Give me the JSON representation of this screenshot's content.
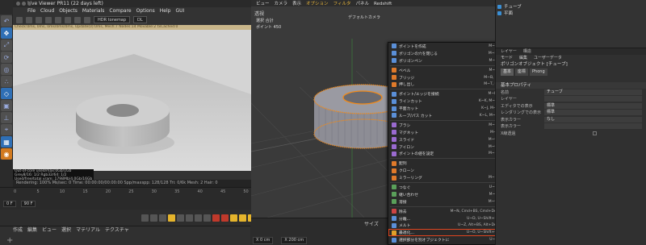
{
  "live_viewer": {
    "title": "Live Viewer PR11 (22 days left)",
    "menu": [
      "File",
      "Cloud",
      "Objects",
      "Materials",
      "Compare",
      "Options",
      "Help",
      "GUI"
    ],
    "tonemap": "HDR tonemap",
    "colorspace": "DL",
    "status": "Check:0ms, 0ms, 0ms/0ms/0ms, Update(0):0ms, Mesh:7 Nodes:14 Movable:2 txCached:0",
    "info_lines": [
      "Out-of-core used/max:0Gb/1Gb",
      "Grey8/16: 1/2        Rgb32/64: 1/2",
      "Used/free/total vram: 1798Mb/4.0Gb/16Gb"
    ],
    "bottom": "Rendering: 100%  Ms/sec: 0  Time: 00:00:00/00:00:00  Spp/maxspp: 128/128  Tri: 0/6k  Mesh: 2  Hair: 0"
  },
  "timeline": {
    "ticks": [
      "0",
      "5",
      "10",
      "15",
      "20",
      "25",
      "30",
      "35",
      "40",
      "45",
      "50",
      "55",
      "60",
      "65",
      "70",
      "75",
      "80"
    ],
    "start_frame": "0 F",
    "end_frame": "90 F"
  },
  "material_bar": {
    "menu": [
      "作成",
      "編集",
      "ビュー",
      "選択",
      "マテリアル",
      "テクスチャ"
    ]
  },
  "viewport": {
    "menu": [
      "ビュー",
      "カメラ",
      "表示",
      "オプション",
      "フィルタ",
      "パネル",
      "Redshift"
    ],
    "highlight_index": 3,
    "label": "透視",
    "camera": "デフォルトカメラ",
    "hud_header": "選択  合計",
    "hud_row": "ポイント  450"
  },
  "coords": {
    "header": "サイズ",
    "row": [
      "X  0 cm",
      "X  200 cm"
    ]
  },
  "context_menu": {
    "items": [
      {
        "label": "ポイントを作成",
        "key": "M~A",
        "color": "#5a8fd8"
      },
      {
        "label": "ポリゴンの穴を閉じる",
        "key": "M~D",
        "color": "#5a8fd8"
      },
      {
        "label": "ポリゴンペン",
        "key": "M~E",
        "color": "#5a8fd8"
      },
      {
        "sep": true
      },
      {
        "label": "ベベル",
        "key": "M~S",
        "color": "#e07a2a"
      },
      {
        "label": "ブリッジ",
        "key": "M~B, B",
        "color": "#e07a2a"
      },
      {
        "label": "押し出し",
        "key": "M~T, D",
        "color": "#e07a2a"
      },
      {
        "sep": true
      },
      {
        "label": "ポイント/エッジを接続",
        "key": "M~M",
        "color": "#5a8fd8"
      },
      {
        "label": "ラインカット",
        "key": "K~K, M~K",
        "color": "#5a8fd8"
      },
      {
        "label": "平面カット",
        "key": "K~J, M~J",
        "color": "#5a8fd8"
      },
      {
        "label": "ループ/パス カット",
        "key": "K~L, M~L",
        "color": "#5a8fd8"
      },
      {
        "sep": true
      },
      {
        "label": "ブラシ",
        "key": "M~C",
        "color": "#9a6ad0"
      },
      {
        "label": "マグネット",
        "key": "M~I",
        "color": "#9a6ad0"
      },
      {
        "label": "スライド",
        "key": "M~O",
        "color": "#9a6ad0"
      },
      {
        "label": "アイロン",
        "key": "M~G",
        "color": "#9a6ad0"
      },
      {
        "label": "ポイントの値を設定",
        "key": "M~U",
        "color": "#9a6ad0"
      },
      {
        "sep": true
      },
      {
        "label": "配列",
        "key": "",
        "color": "#e07a2a"
      },
      {
        "label": "クローン",
        "key": "",
        "color": "#e07a2a"
      },
      {
        "label": "ミラーリング",
        "key": "M~H",
        "color": "#e07a2a"
      },
      {
        "sep": true
      },
      {
        "label": "つなぐ",
        "key": "U~C",
        "color": "#5aa05a"
      },
      {
        "label": "継い合わせ",
        "key": "M~P",
        "color": "#5aa05a"
      },
      {
        "label": "溶接",
        "key": "M~Q",
        "color": "#5aa05a"
      },
      {
        "sep": true
      },
      {
        "label": "除去",
        "key": "M~N, Cmd+BS, Cmd+Del",
        "color": "#cc4444"
      },
      {
        "label": "分離...",
        "key": "U~D, U~Shift+D",
        "color": "#5a8fd8"
      },
      {
        "label": "メルト",
        "key": "U~Z, Alt+BS, Alt+Del",
        "color": "#5a8fd8"
      },
      {
        "label": "最適化...",
        "key": "U~O, U~Shift+O",
        "color": "#e0a02a",
        "highlight": true
      },
      {
        "label": "選択部分を別オブジェクトに",
        "key": "U~P",
        "color": "#5a8fd8"
      }
    ]
  },
  "objects": {
    "items": [
      "チューブ",
      "平面"
    ]
  },
  "attributes": {
    "tabs": [
      "レイヤー",
      "構造"
    ],
    "menu": [
      "モード",
      "編集",
      "ユーザーデータ"
    ],
    "title": "ポリゴンオブジェクト [チューブ]",
    "buttons": [
      "基本",
      "座標",
      "Phong"
    ],
    "section": "基本プロパティ",
    "fields": [
      {
        "key": "名前",
        "value": "チューブ"
      },
      {
        "key": "レイヤー",
        "value": ""
      },
      {
        "key": "エディタでの表示",
        "value": "標準"
      },
      {
        "key": "レンダリングでの表示",
        "value": "標準"
      },
      {
        "key": "表示カラー",
        "value": "なし"
      },
      {
        "key": "表示カラー",
        "value": ""
      }
    ],
    "checkbox_label": "X線透過"
  },
  "colors": {
    "accent_orange": "#e0a02a",
    "highlight_red": "#e0451f",
    "selection_blue": "#2f6fb5"
  }
}
